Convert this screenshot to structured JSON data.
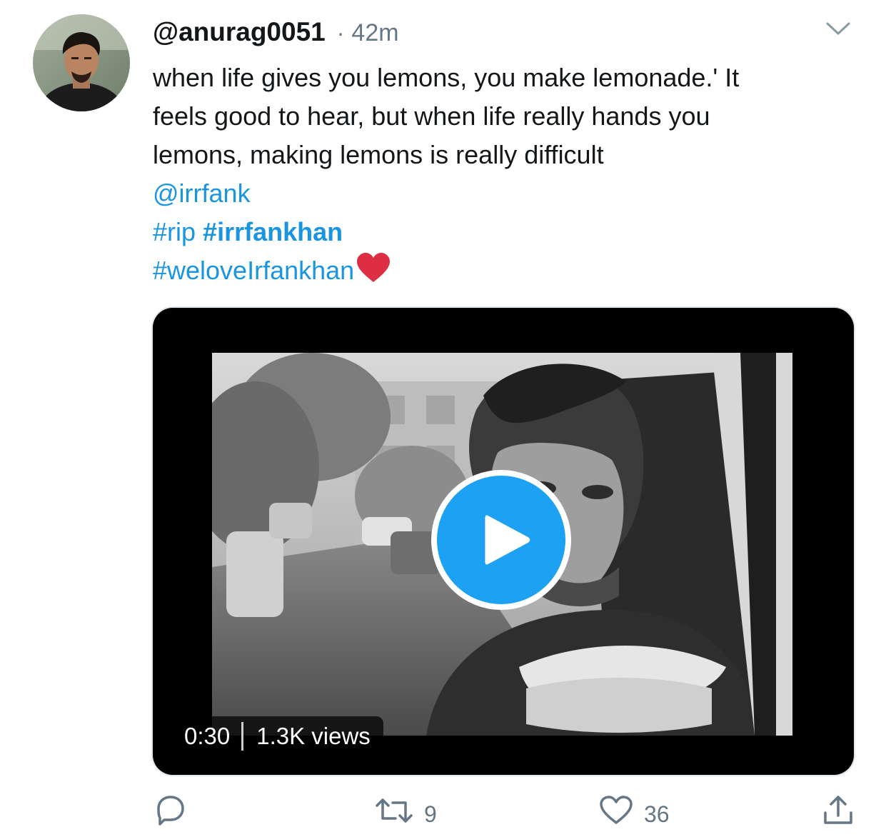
{
  "tweet": {
    "author_handle": "@anurag0051",
    "separator": "·",
    "time_ago": "42m",
    "text_lines": [
      "when life gives you lemons, you make lemonade.' It",
      "feels good to hear, but when life really hands you",
      "lemons, making lemons is really difficult"
    ],
    "mention": "@irrfank",
    "hashtag_1": "#rip",
    "hashtag_2": "#irrfankhan",
    "hashtag_3": "#weloveIrfankhan",
    "emoji_icon": "red-heart-emoji"
  },
  "media": {
    "type": "video",
    "duration": "0:30",
    "views": "1.3K views",
    "play_icon": "play-icon"
  },
  "actions": {
    "reply_count": "",
    "retweet_count": "9",
    "like_count": "36",
    "share_count": ""
  },
  "colors": {
    "link": "#1b95e0",
    "play_button": "#1da1f2",
    "secondary_text": "#657786",
    "heart": "#e0245e"
  }
}
